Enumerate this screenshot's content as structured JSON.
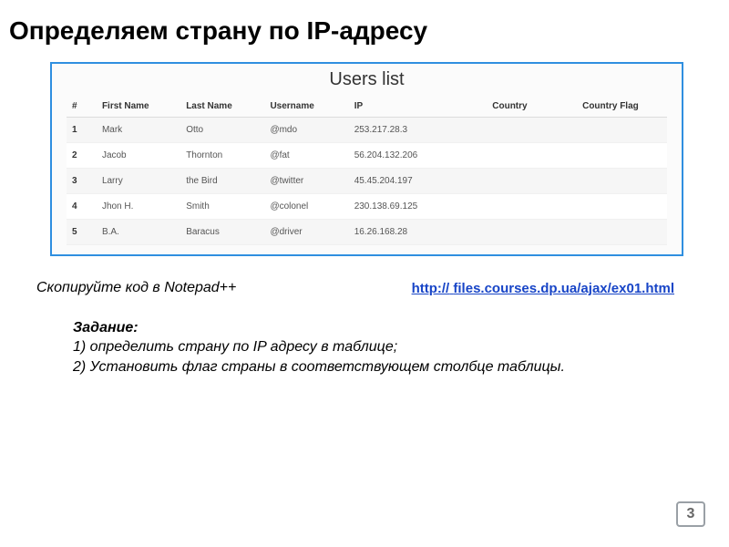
{
  "heading": "Определяем страну по IP-адресу",
  "panel": {
    "title": "Users list",
    "columns": {
      "num": "#",
      "firstName": "First Name",
      "lastName": "Last Name",
      "username": "Username",
      "ip": "IP",
      "country": "Country",
      "countryFlag": "Country Flag"
    },
    "rows": [
      {
        "num": "1",
        "firstName": "Mark",
        "lastName": "Otto",
        "username": "@mdo",
        "ip": "253.217.28.3",
        "country": "",
        "flag": ""
      },
      {
        "num": "2",
        "firstName": "Jacob",
        "lastName": "Thornton",
        "username": "@fat",
        "ip": "56.204.132.206",
        "country": "",
        "flag": ""
      },
      {
        "num": "3",
        "firstName": "Larry",
        "lastName": "the Bird",
        "username": "@twitter",
        "ip": "45.45.204.197",
        "country": "",
        "flag": ""
      },
      {
        "num": "4",
        "firstName": "Jhon H.",
        "lastName": "Smith",
        "username": "@colonel",
        "ip": "230.138.69.125",
        "country": "",
        "flag": ""
      },
      {
        "num": "5",
        "firstName": "B.A.",
        "lastName": "Baracus",
        "username": "@driver",
        "ip": "16.26.168.28",
        "country": "",
        "flag": ""
      }
    ]
  },
  "instruction": "Скопируйте код в Notepad++",
  "link": {
    "line1": "http://",
    "line2": "files.courses.dp.ua/ajax/ex01.html"
  },
  "task": {
    "heading": "Задание:",
    "item1": "1) определить страну по IP адресу в таблице;",
    "item2": "2) Установить флаг страны в соответствующем столбце таблицы."
  },
  "pageNumber": "3"
}
